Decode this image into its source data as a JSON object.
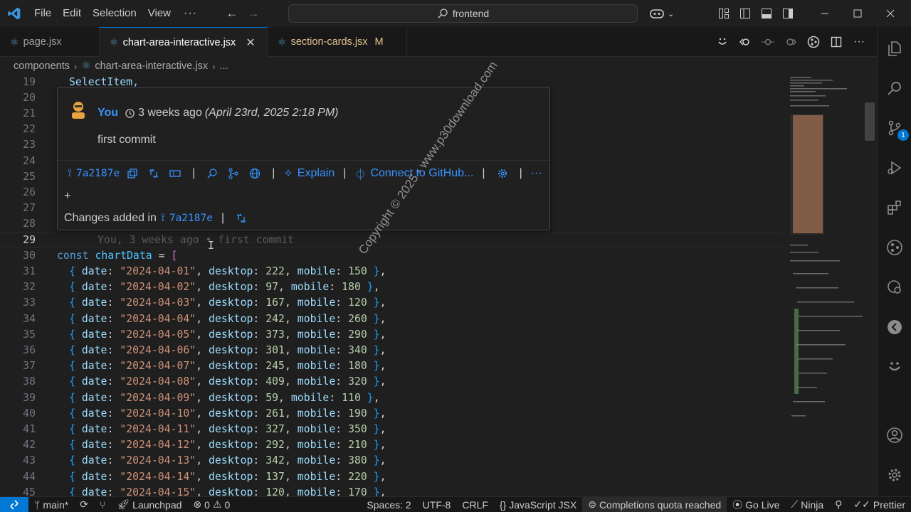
{
  "titlebar": {
    "menus": [
      "File",
      "Edit",
      "Selection",
      "View"
    ],
    "more": "···",
    "search_text": "frontend"
  },
  "tabs": [
    {
      "label": "page.jsx",
      "active": false,
      "modified": ""
    },
    {
      "label": "chart-area-interactive.jsx",
      "active": true,
      "modified": ""
    },
    {
      "label": "section-cards.jsx",
      "active": false,
      "modified": "M"
    }
  ],
  "breadcrumb": {
    "folder": "components",
    "file": "chart-area-interactive.jsx",
    "more": "..."
  },
  "hover": {
    "author": "You",
    "relative_time": "3 weeks ago",
    "absolute_time": "(April 23rd, 2025 2:18 PM)",
    "message": "first commit",
    "sha": "7a2187e",
    "explain": "Explain",
    "connect": "Connect to GitHub...",
    "plus": "+",
    "changes_label": "Changes added in",
    "changes_sha": "7a2187e"
  },
  "watermark": "Copyright © 2025 - www.p30download.com",
  "editor": {
    "line19": "SelectItem,",
    "line29_blame": "You, 3 weeks ago • first commit",
    "decl_kw": "const",
    "decl_name": "chartData",
    "decl_rest": " = ",
    "decl_bracket": "[",
    "rows": [
      {
        "ln": "31",
        "date": "\"2024-04-01\"",
        "desktop": "222",
        "mobile": "150"
      },
      {
        "ln": "32",
        "date": "\"2024-04-02\"",
        "desktop": "97",
        "mobile": "180"
      },
      {
        "ln": "33",
        "date": "\"2024-04-03\"",
        "desktop": "167",
        "mobile": "120"
      },
      {
        "ln": "34",
        "date": "\"2024-04-04\"",
        "desktop": "242",
        "mobile": "260"
      },
      {
        "ln": "35",
        "date": "\"2024-04-05\"",
        "desktop": "373",
        "mobile": "290"
      },
      {
        "ln": "36",
        "date": "\"2024-04-06\"",
        "desktop": "301",
        "mobile": "340"
      },
      {
        "ln": "37",
        "date": "\"2024-04-07\"",
        "desktop": "245",
        "mobile": "180"
      },
      {
        "ln": "38",
        "date": "\"2024-04-08\"",
        "desktop": "409",
        "mobile": "320"
      },
      {
        "ln": "39",
        "date": "\"2024-04-09\"",
        "desktop": "59",
        "mobile": "110"
      },
      {
        "ln": "40",
        "date": "\"2024-04-10\"",
        "desktop": "261",
        "mobile": "190"
      },
      {
        "ln": "41",
        "date": "\"2024-04-11\"",
        "desktop": "327",
        "mobile": "350"
      },
      {
        "ln": "42",
        "date": "\"2024-04-12\"",
        "desktop": "292",
        "mobile": "210"
      },
      {
        "ln": "43",
        "date": "\"2024-04-13\"",
        "desktop": "342",
        "mobile": "380"
      },
      {
        "ln": "44",
        "date": "\"2024-04-14\"",
        "desktop": "137",
        "mobile": "220"
      },
      {
        "ln": "45",
        "date": "\"2024-04-15\"",
        "desktop": "120",
        "mobile": "170"
      }
    ],
    "line_numbers_top": [
      "19",
      "20",
      "21",
      "22",
      "23",
      "24",
      "25",
      "26",
      "27",
      "28",
      "29",
      "30"
    ]
  },
  "statusbar": {
    "branch": "main*",
    "launchpad": "Launchpad",
    "errors": "0",
    "warnings": "0",
    "spaces": "Spaces: 2",
    "encoding": "UTF-8",
    "eol": "CRLF",
    "language": "JavaScript JSX",
    "copilot": "Completions quota reached",
    "golive": "Go Live",
    "ninja": "Ninja",
    "prettier": "Prettier"
  },
  "colors": {
    "accent": "#0078d4",
    "link": "#3794ff"
  }
}
